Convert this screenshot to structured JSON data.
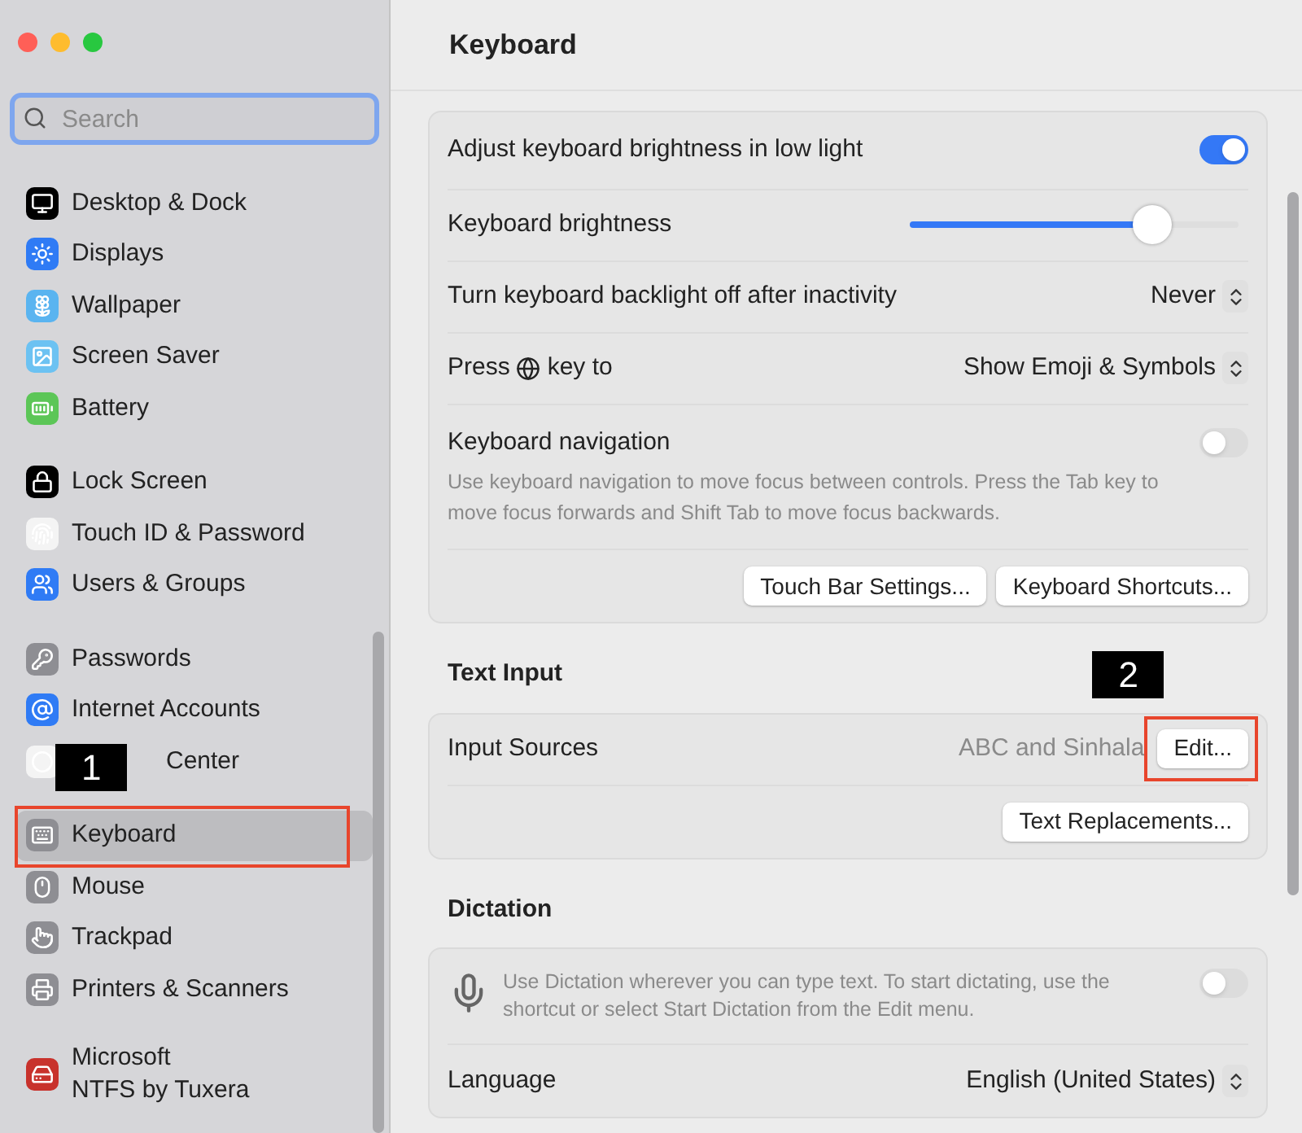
{
  "sidebar": {
    "search": {
      "placeholder": "Search"
    },
    "groups": [
      [
        {
          "label": "Desktop & Dock",
          "selected": false
        },
        {
          "label": "Displays",
          "selected": false
        },
        {
          "label": "Wallpaper",
          "selected": false
        },
        {
          "label": "Screen Saver",
          "selected": false
        },
        {
          "label": "Battery",
          "selected": false
        }
      ],
      [
        {
          "label": "Lock Screen",
          "selected": false
        },
        {
          "label": "Touch ID & Password",
          "selected": false
        },
        {
          "label": "Users & Groups",
          "selected": false
        }
      ],
      [
        {
          "label": "Passwords",
          "selected": false
        },
        {
          "label": "Internet Accounts",
          "selected": false
        },
        {
          "label": "Center",
          "selected": false,
          "annotation": "1"
        }
      ],
      [
        {
          "label": "Keyboard",
          "selected": true,
          "highlighted": true
        },
        {
          "label": "Mouse",
          "selected": false
        },
        {
          "label": "Trackpad",
          "selected": false
        },
        {
          "label": "Printers & Scanners",
          "selected": false
        }
      ],
      [
        {
          "label": "Microsoft\nNTFS by Tuxera",
          "selected": false
        }
      ]
    ]
  },
  "main": {
    "title": "Keyboard",
    "sections": [
      {
        "rows": [
          {
            "kind": "toggle",
            "label": "Adjust keyboard brightness in low light",
            "on": true
          },
          {
            "kind": "slider",
            "label": "Keyboard brightness",
            "level": 0.74
          },
          {
            "kind": "select",
            "label": "Turn keyboard backlight off after inactivity",
            "value": "Never"
          },
          {
            "kind": "globe-select",
            "label": "Press",
            "label_after": "key to",
            "value": "Show Emoji & Symbols"
          },
          {
            "kind": "toggle",
            "label": "Keyboard navigation",
            "on": false,
            "description": "Use keyboard navigation to move focus between controls. Press the Tab key to move focus forwards and Shift Tab to move focus backwards."
          },
          {
            "kind": "buttons",
            "buttons": [
              {
                "label": "Touch Bar Settings..."
              },
              {
                "label": "Keyboard Shortcuts..."
              }
            ]
          }
        ]
      },
      {
        "heading": "Text Input",
        "rows": [
          {
            "kind": "value-button",
            "label": "Input Sources",
            "value": "ABC and Sinhala",
            "button": "Edit...",
            "annotation": "2"
          },
          {
            "kind": "buttons",
            "buttons": [
              {
                "label": "Text Replacements..."
              }
            ]
          }
        ]
      },
      {
        "heading": "Dictation",
        "rows": [
          {
            "kind": "mic-toggle",
            "description": "Use Dictation wherever you can type text. To start dictating, use the shortcut or select Start Dictation from the Edit menu.",
            "on": false
          },
          {
            "kind": "select",
            "label": "Language",
            "value": "English (United States)"
          }
        ]
      }
    ]
  }
}
